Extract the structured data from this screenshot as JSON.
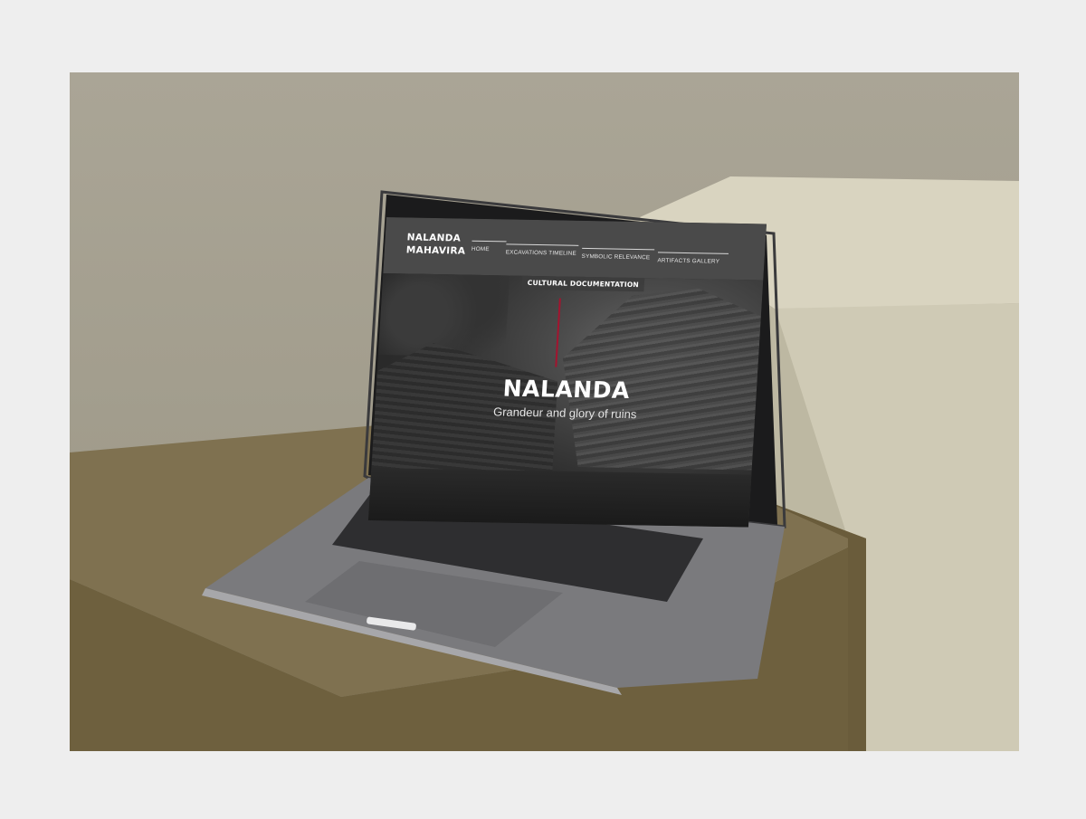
{
  "site": {
    "logo_line1": "NALANDA",
    "logo_line2": "MAHAVIRA"
  },
  "nav": {
    "items": [
      {
        "label": "HOME"
      },
      {
        "label": "EXCAVATIONS TIMELINE"
      },
      {
        "label": "SYMBOLIC RELEVANCE"
      },
      {
        "label": "ARTIFACTS GALLERY"
      }
    ]
  },
  "hero": {
    "badge": "CULTURAL DOCUMENTATION",
    "title": "NALANDA",
    "subtitle": "Grandeur and glory of ruins",
    "accent_color": "#a3142f"
  },
  "scene": {
    "background_color": "#eeeeee",
    "wall_color": "#a6a191",
    "pedestal_front_color": "#7a6c47",
    "pedestal_back_color": "#d6d1bd",
    "laptop_color": "#6b6b6d"
  }
}
